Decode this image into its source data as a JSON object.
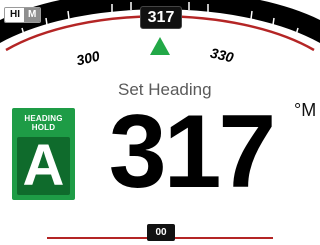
{
  "mode_badge": {
    "hi": "HI",
    "m": "M"
  },
  "heading": {
    "current": "317"
  },
  "compass": {
    "tick_labels": [
      "300",
      "330"
    ]
  },
  "set_heading": {
    "label": "Set Heading",
    "value": "317",
    "unit": "°M"
  },
  "mode": {
    "title_line1": "HEADING",
    "title_line2": "HOLD",
    "letter": "A"
  },
  "rudder": {
    "value": "00"
  },
  "colors": {
    "arc_red": "#b42525",
    "arrow_green": "#22a847",
    "mode_green": "#1e9c46",
    "mode_dark_green": "#0f6b2c"
  }
}
